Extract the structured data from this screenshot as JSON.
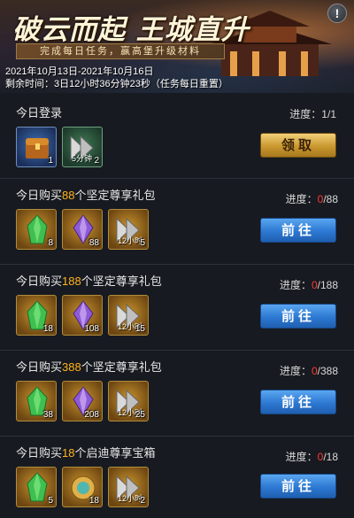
{
  "banner": {
    "title": "破云而起 王城直升",
    "subtitle": "完成每日任务，赢高堡升级材料",
    "date_range": "2021年10月13日-2021年10月16日",
    "remaining": "剩余时间：3日12小时36分钟23秒（任务每日重置）",
    "help_label": "!"
  },
  "tasks": [
    {
      "title": "今日登录",
      "progress_label": "进度：",
      "progress_current": "1",
      "progress_total": "/1",
      "button": "领取",
      "items": [
        {
          "icon": "treasure-chest-icon",
          "qty": "1",
          "tag": ""
        },
        {
          "icon": "speedup-icon",
          "qty": "2",
          "tag": "5分钟"
        }
      ]
    },
    {
      "title_prefix": "今日购买",
      "title_amount": "88",
      "title_suffix": "个坚定尊享礼包",
      "progress_label": "进度：",
      "progress_current": "0",
      "progress_total": "/88",
      "button": "前往",
      "items": [
        {
          "icon": "green-crystal-icon",
          "qty": "8",
          "tag": ""
        },
        {
          "icon": "purple-crystal-icon",
          "qty": "88",
          "tag": ""
        },
        {
          "icon": "speedup-icon",
          "qty": "5",
          "tag": "12小时"
        }
      ]
    },
    {
      "title_prefix": "今日购买",
      "title_amount": "188",
      "title_suffix": "个坚定尊享礼包",
      "progress_label": "进度：",
      "progress_current": "0",
      "progress_total": "/188",
      "button": "前往",
      "items": [
        {
          "icon": "green-crystal-icon",
          "qty": "18",
          "tag": ""
        },
        {
          "icon": "purple-crystal-icon",
          "qty": "108",
          "tag": ""
        },
        {
          "icon": "speedup-icon",
          "qty": "15",
          "tag": "12小时"
        }
      ]
    },
    {
      "title_prefix": "今日购买",
      "title_amount": "388",
      "title_suffix": "个坚定尊享礼包",
      "progress_label": "进度：",
      "progress_current": "0",
      "progress_total": "/388",
      "button": "前往",
      "items": [
        {
          "icon": "green-crystal-icon",
          "qty": "38",
          "tag": ""
        },
        {
          "icon": "purple-crystal-icon",
          "qty": "208",
          "tag": ""
        },
        {
          "icon": "speedup-icon",
          "qty": "25",
          "tag": "12小时"
        }
      ]
    },
    {
      "title_prefix": "今日购买",
      "title_amount": "18",
      "title_suffix": "个启迪尊享宝箱",
      "progress_label": "进度：",
      "progress_current": "0",
      "progress_total": "/18",
      "button": "前往",
      "items": [
        {
          "icon": "green-crystal-icon",
          "qty": "5",
          "tag": ""
        },
        {
          "icon": "gold-orb-icon",
          "qty": "18",
          "tag": ""
        },
        {
          "icon": "speedup-icon",
          "qty": "2",
          "tag": "12小时"
        }
      ]
    }
  ]
}
